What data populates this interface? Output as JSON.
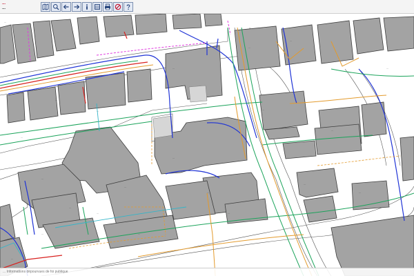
{
  "app": {
    "brand_line1": "...",
    "brand_line2": "...",
    "toolbar": [
      {
        "id": "map",
        "icon": "map-icon",
        "title": ""
      },
      {
        "id": "zoom",
        "icon": "zoom-icon",
        "title": ""
      },
      {
        "id": "back",
        "icon": "arrow-left-icon",
        "title": ""
      },
      {
        "id": "forward",
        "icon": "arrow-right-icon",
        "title": ""
      },
      {
        "id": "info",
        "icon": "info-icon",
        "title": ""
      },
      {
        "id": "layers",
        "icon": "layers-icon",
        "title": ""
      },
      {
        "id": "print",
        "icon": "print-icon",
        "title": ""
      },
      {
        "id": "edit",
        "icon": "edit-icon",
        "title": ""
      },
      {
        "id": "help",
        "icon": "help-icon",
        "title": ""
      }
    ]
  },
  "map": {
    "labels": [
      "...",
      "...",
      "...",
      "...",
      "...",
      "...",
      "...",
      "...",
      "...",
      "...",
      "...",
      "...",
      "...",
      "...",
      "...",
      "...",
      "...",
      "...",
      "...",
      "...",
      "...",
      "...",
      "...",
      "..."
    ],
    "colors": {
      "building": "#a3a3a3",
      "outline": "#3c3c3c",
      "network_blue": "#1f33d6",
      "network_green": "#1aa35a",
      "network_orange": "#e39a2c",
      "network_red": "#d8201e",
      "network_magenta": "#e03bdf",
      "network_cyan": "#33b5c9"
    }
  },
  "status": {
    "text": "... Informations dépourvues de foi publique"
  }
}
